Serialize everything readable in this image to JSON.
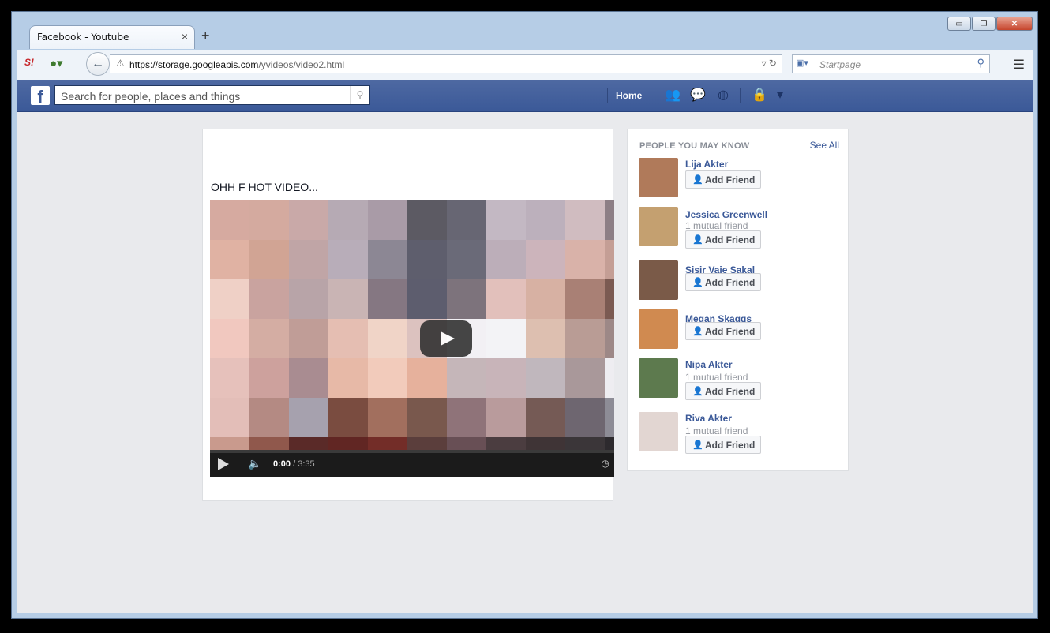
{
  "browser": {
    "tab_title": "Facebook - Youtube",
    "tab_close": "×",
    "new_tab": "+",
    "url_host": "https://storage.googleapis.com",
    "url_path": "/yvideos/video2.html",
    "search_placeholder": "Startpage",
    "window_buttons": {
      "minimize": "▭",
      "maximize": "❐",
      "close": "✕"
    }
  },
  "facebook": {
    "logo": "f",
    "search_placeholder": "Search for people, places and things",
    "home_label": "Home"
  },
  "post": {
    "text": "OHH F HOT VIDEO...",
    "video": {
      "current_time": "0:00",
      "duration": " / 3:35",
      "mosaic_colors": [
        "#d6aaa0",
        "#d4aa9f",
        "#c9a9a8",
        "#b6aab4",
        "#a99ba7",
        "#5c5a63",
        "#676673",
        "#c3b8c3",
        "#bcb0bc",
        "#d0bcc0",
        "#8d7f86",
        "#e0b2a3",
        "#d1a494",
        "#c0a5a6",
        "#b8adb9",
        "#8c8794",
        "#5e5e6d",
        "#6a6a78",
        "#bcaeb9",
        "#ccb4bb",
        "#d9b2a9",
        "#c49e95",
        "#efd0c6",
        "#c9a39f",
        "#b8a4a8",
        "#c9b4b4",
        "#857782",
        "#5d5d6e",
        "#7d737c",
        "#e2c0bb",
        "#d7b1a3",
        "#a98075",
        "#7b5a52",
        "#f1c8bf",
        "#d4ada3",
        "#c09d97",
        "#e5beb2",
        "#f0d4c7",
        "#dcc2bf",
        "#f2f0f4",
        "#f3f3f6",
        "#ddbfb0",
        "#b99c95",
        "#9d8887",
        "#e6c1bb",
        "#cda19d",
        "#a98c91",
        "#e7b9a7",
        "#f2cbbb",
        "#e6b19c",
        "#c5b6b9",
        "#c8b4b9",
        "#c0b7bd",
        "#a9989a",
        "#eeedf1",
        "#e3beb8",
        "#b48a83",
        "#a6a1ae",
        "#7a4c40",
        "#a26f5e",
        "#79584d",
        "#8f7379",
        "#b99b9c",
        "#755a55",
        "#6e6670",
        "#8d8c96",
        "#c99a8d",
        "#90584c",
        "#5a2a28",
        "#612623",
        "#732d28",
        "#5b3e3c",
        "#684f55",
        "#4b3d40",
        "#3f3436",
        "#3b3639",
        "#2d2a2e"
      ]
    }
  },
  "pymk": {
    "title": "PEOPLE YOU MAY KNOW",
    "see_all": "See All",
    "add_friend_label": "Add Friend",
    "people": [
      {
        "name": "Lija Akter",
        "mutual": "",
        "avatar_color": "#b07a5a"
      },
      {
        "name": "Jessica Greenwell",
        "mutual": "1 mutual friend",
        "avatar_color": "#c4a070"
      },
      {
        "name": "Sisir Vaje Sakal",
        "mutual": "",
        "avatar_color": "#7a5a48"
      },
      {
        "name": "Megan Skaggs",
        "mutual": "",
        "avatar_color": "#d08a50"
      },
      {
        "name": "Nipa Akter",
        "mutual": "1 mutual friend",
        "avatar_color": "#5d7a4e"
      },
      {
        "name": "Riva Akter",
        "mutual": "1 mutual friend",
        "avatar_color": "#e2d6d2"
      }
    ]
  }
}
